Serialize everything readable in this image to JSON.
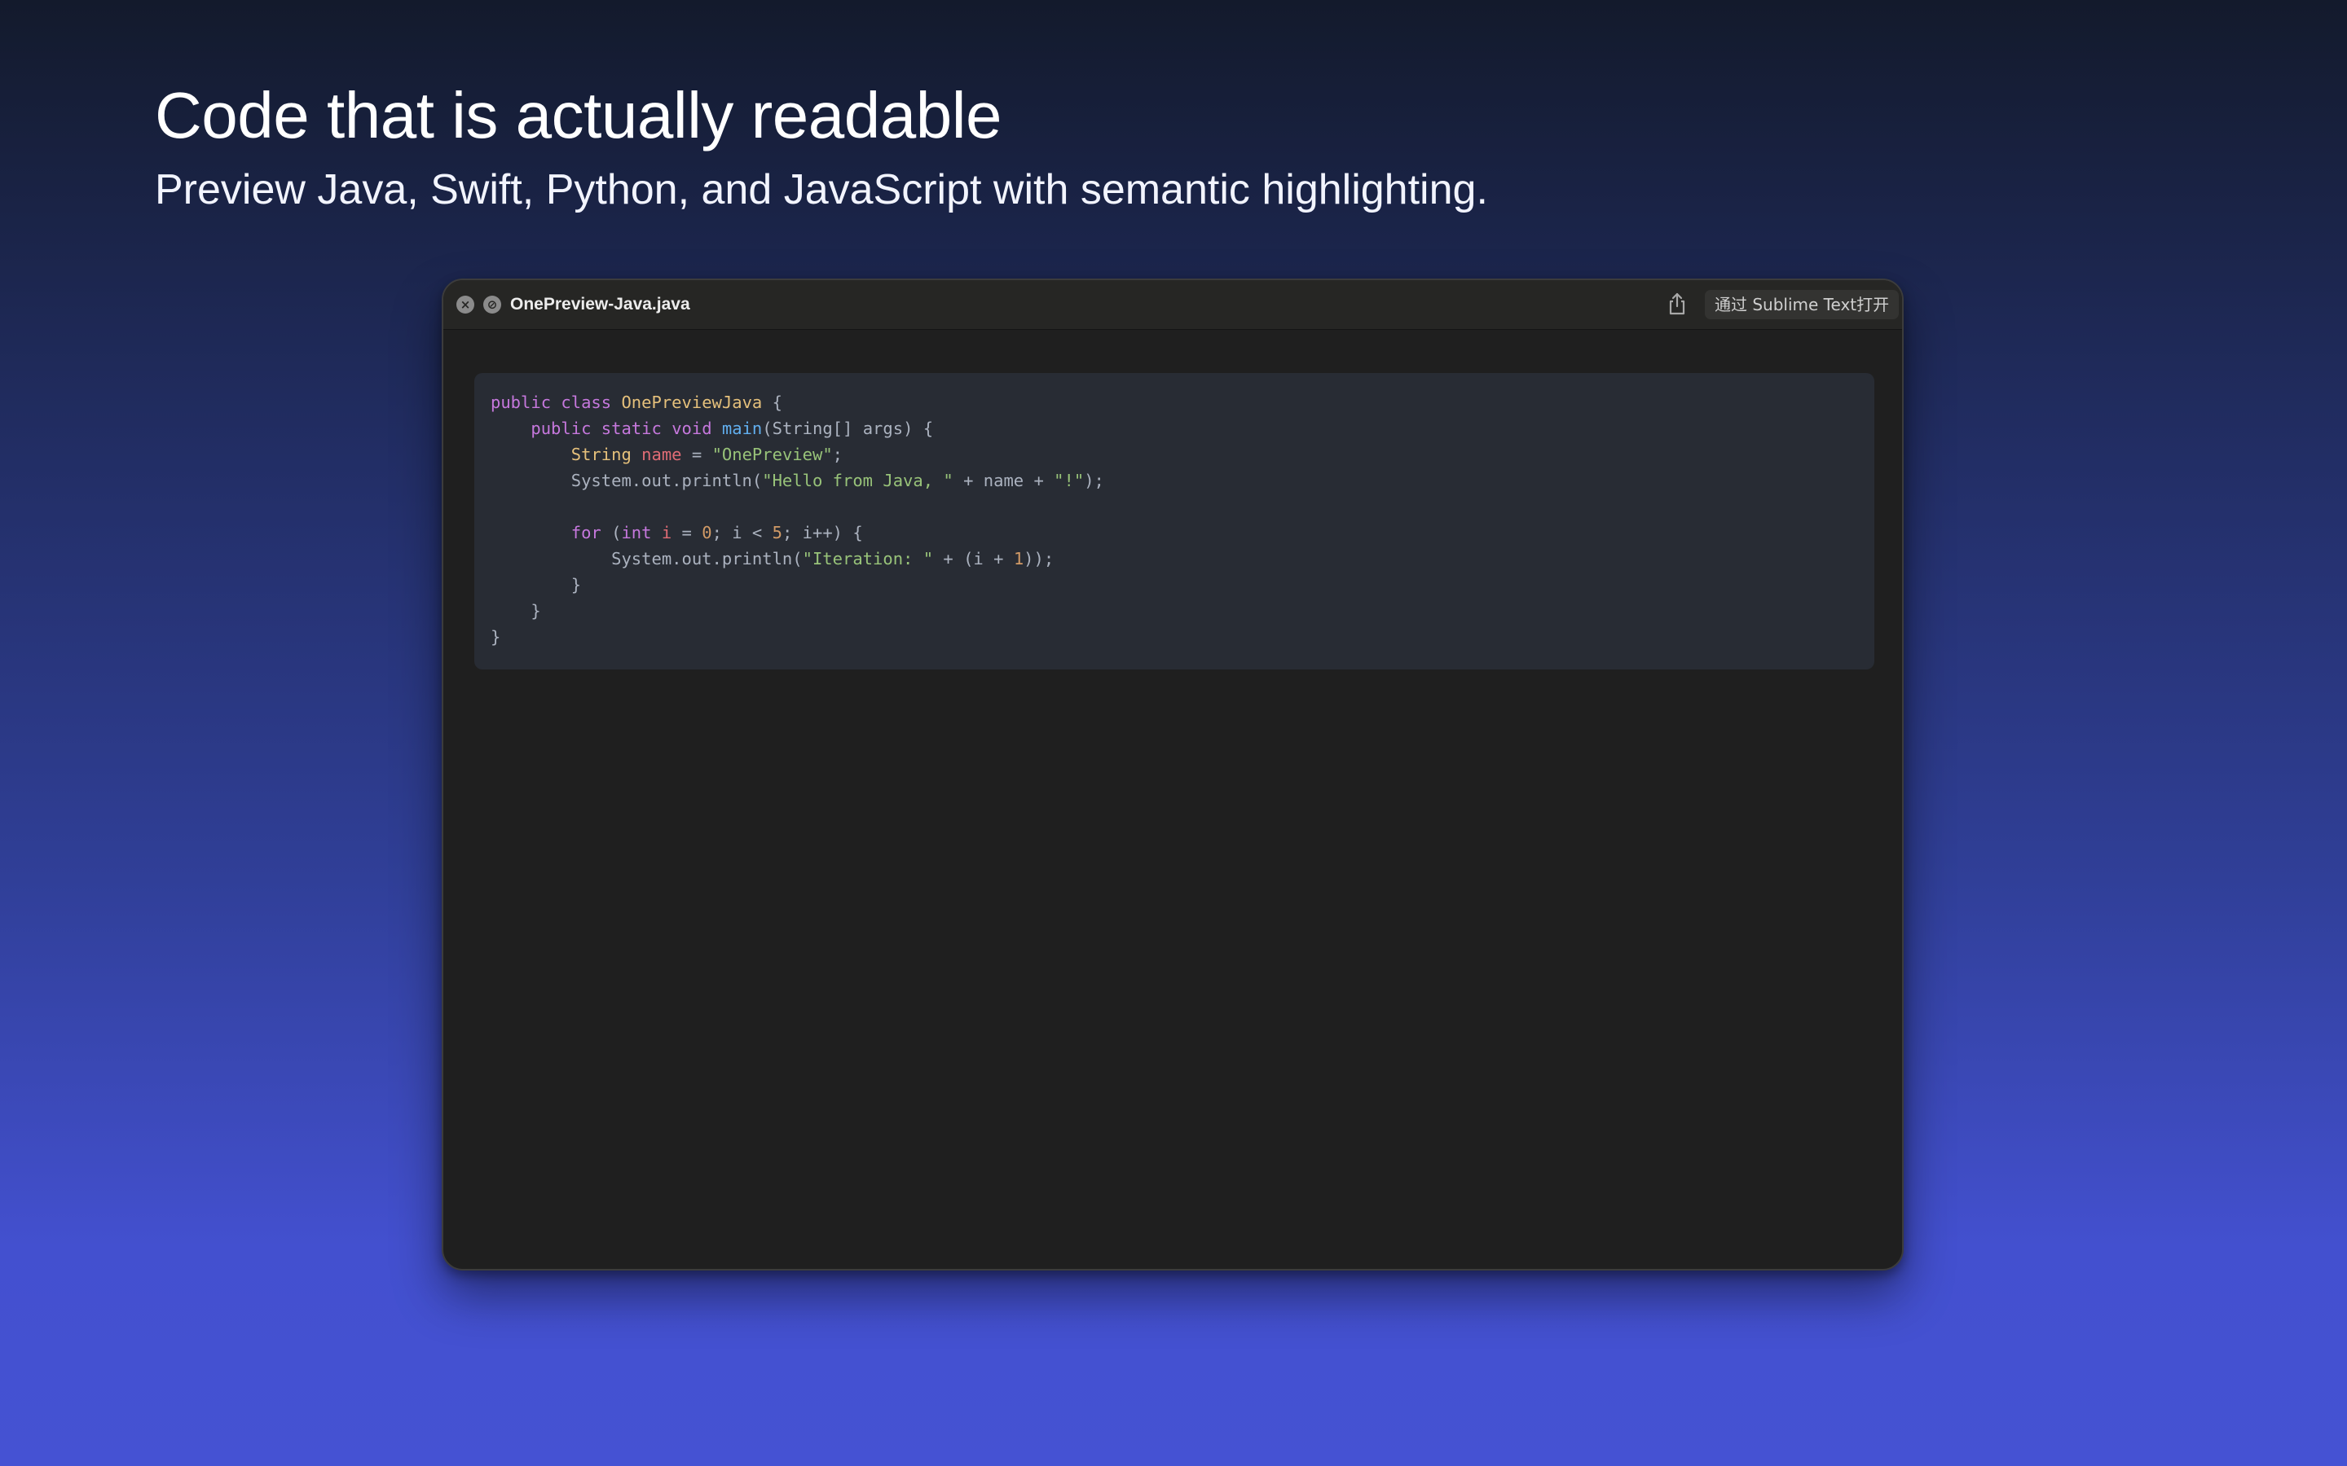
{
  "hero": {
    "title": "Code that is actually readable",
    "subtitle": "Preview Java, Swift, Python, and JavaScript with semantic highlighting."
  },
  "window": {
    "filename": "OnePreview-Java.java",
    "close_icon": "close-icon",
    "fullscreen_icon": "fullscreen-icon",
    "share_icon": "share-icon",
    "open_with_label": "通过 Sublime Text打开"
  },
  "colors": {
    "keyword": "#c678dd",
    "class_name": "#e5c07b",
    "function": "#61afef",
    "string": "#98c379",
    "number": "#d19a66",
    "plain": "#abb2bf",
    "code_background": "#282c34",
    "window_background": "#1f1f1f"
  },
  "code": {
    "lines": [
      [
        {
          "t": "public",
          "c": "kw"
        },
        {
          "t": " ",
          "c": "plain"
        },
        {
          "t": "class",
          "c": "kw"
        },
        {
          "t": " ",
          "c": "plain"
        },
        {
          "t": "OnePreviewJava",
          "c": "cls"
        },
        {
          "t": " {",
          "c": "plain"
        }
      ],
      [
        {
          "t": "    ",
          "c": "plain"
        },
        {
          "t": "public",
          "c": "kw"
        },
        {
          "t": " ",
          "c": "plain"
        },
        {
          "t": "static",
          "c": "kw"
        },
        {
          "t": " ",
          "c": "plain"
        },
        {
          "t": "void",
          "c": "kw"
        },
        {
          "t": " ",
          "c": "plain"
        },
        {
          "t": "main",
          "c": "fn"
        },
        {
          "t": "(String[] args) {",
          "c": "plain"
        }
      ],
      [
        {
          "t": "        ",
          "c": "plain"
        },
        {
          "t": "String",
          "c": "cls"
        },
        {
          "t": " ",
          "c": "plain"
        },
        {
          "t": "name",
          "c": "var"
        },
        {
          "t": " = ",
          "c": "plain"
        },
        {
          "t": "\"OnePreview\"",
          "c": "str"
        },
        {
          "t": ";",
          "c": "plain"
        }
      ],
      [
        {
          "t": "        System.out.println(",
          "c": "plain"
        },
        {
          "t": "\"Hello from Java, \"",
          "c": "str"
        },
        {
          "t": " + name + ",
          "c": "plain"
        },
        {
          "t": "\"!\"",
          "c": "str"
        },
        {
          "t": ");",
          "c": "plain"
        }
      ],
      [],
      [
        {
          "t": "        ",
          "c": "plain"
        },
        {
          "t": "for",
          "c": "kw"
        },
        {
          "t": " (",
          "c": "plain"
        },
        {
          "t": "int",
          "c": "kw"
        },
        {
          "t": " ",
          "c": "plain"
        },
        {
          "t": "i",
          "c": "var"
        },
        {
          "t": " = ",
          "c": "plain"
        },
        {
          "t": "0",
          "c": "num"
        },
        {
          "t": "; i < ",
          "c": "plain"
        },
        {
          "t": "5",
          "c": "num"
        },
        {
          "t": "; i++) {",
          "c": "plain"
        }
      ],
      [
        {
          "t": "            System.out.println(",
          "c": "plain"
        },
        {
          "t": "\"Iteration: \"",
          "c": "str"
        },
        {
          "t": " + (i + ",
          "c": "plain"
        },
        {
          "t": "1",
          "c": "num"
        },
        {
          "t": "));",
          "c": "plain"
        }
      ],
      [
        {
          "t": "        }",
          "c": "plain"
        }
      ],
      [
        {
          "t": "    }",
          "c": "plain"
        }
      ],
      [
        {
          "t": "}",
          "c": "plain"
        }
      ]
    ]
  }
}
